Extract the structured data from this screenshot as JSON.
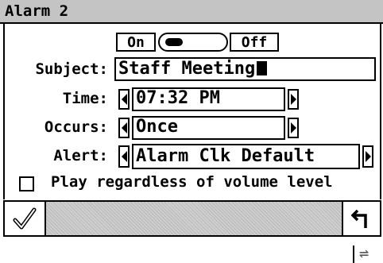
{
  "window": {
    "title": "Alarm 2"
  },
  "toggle": {
    "on_label": "On",
    "off_label": "Off",
    "state": "on"
  },
  "fields": {
    "subject": {
      "label": "Subject:",
      "value": "Staff Meeting"
    },
    "time": {
      "label": "Time:",
      "value": "07:32 PM"
    },
    "occurs": {
      "label": "Occurs:",
      "value": "Once"
    },
    "alert": {
      "label": "Alert:",
      "value": "Alarm Clk Default"
    }
  },
  "option": {
    "label": "Play regardless of volume level",
    "checked": false
  },
  "command_bar": {
    "ok_icon": "checkmark-icon",
    "back_icon": "return-arrow-icon"
  },
  "status_bar": {
    "icon": "sync-arrows-icon"
  }
}
